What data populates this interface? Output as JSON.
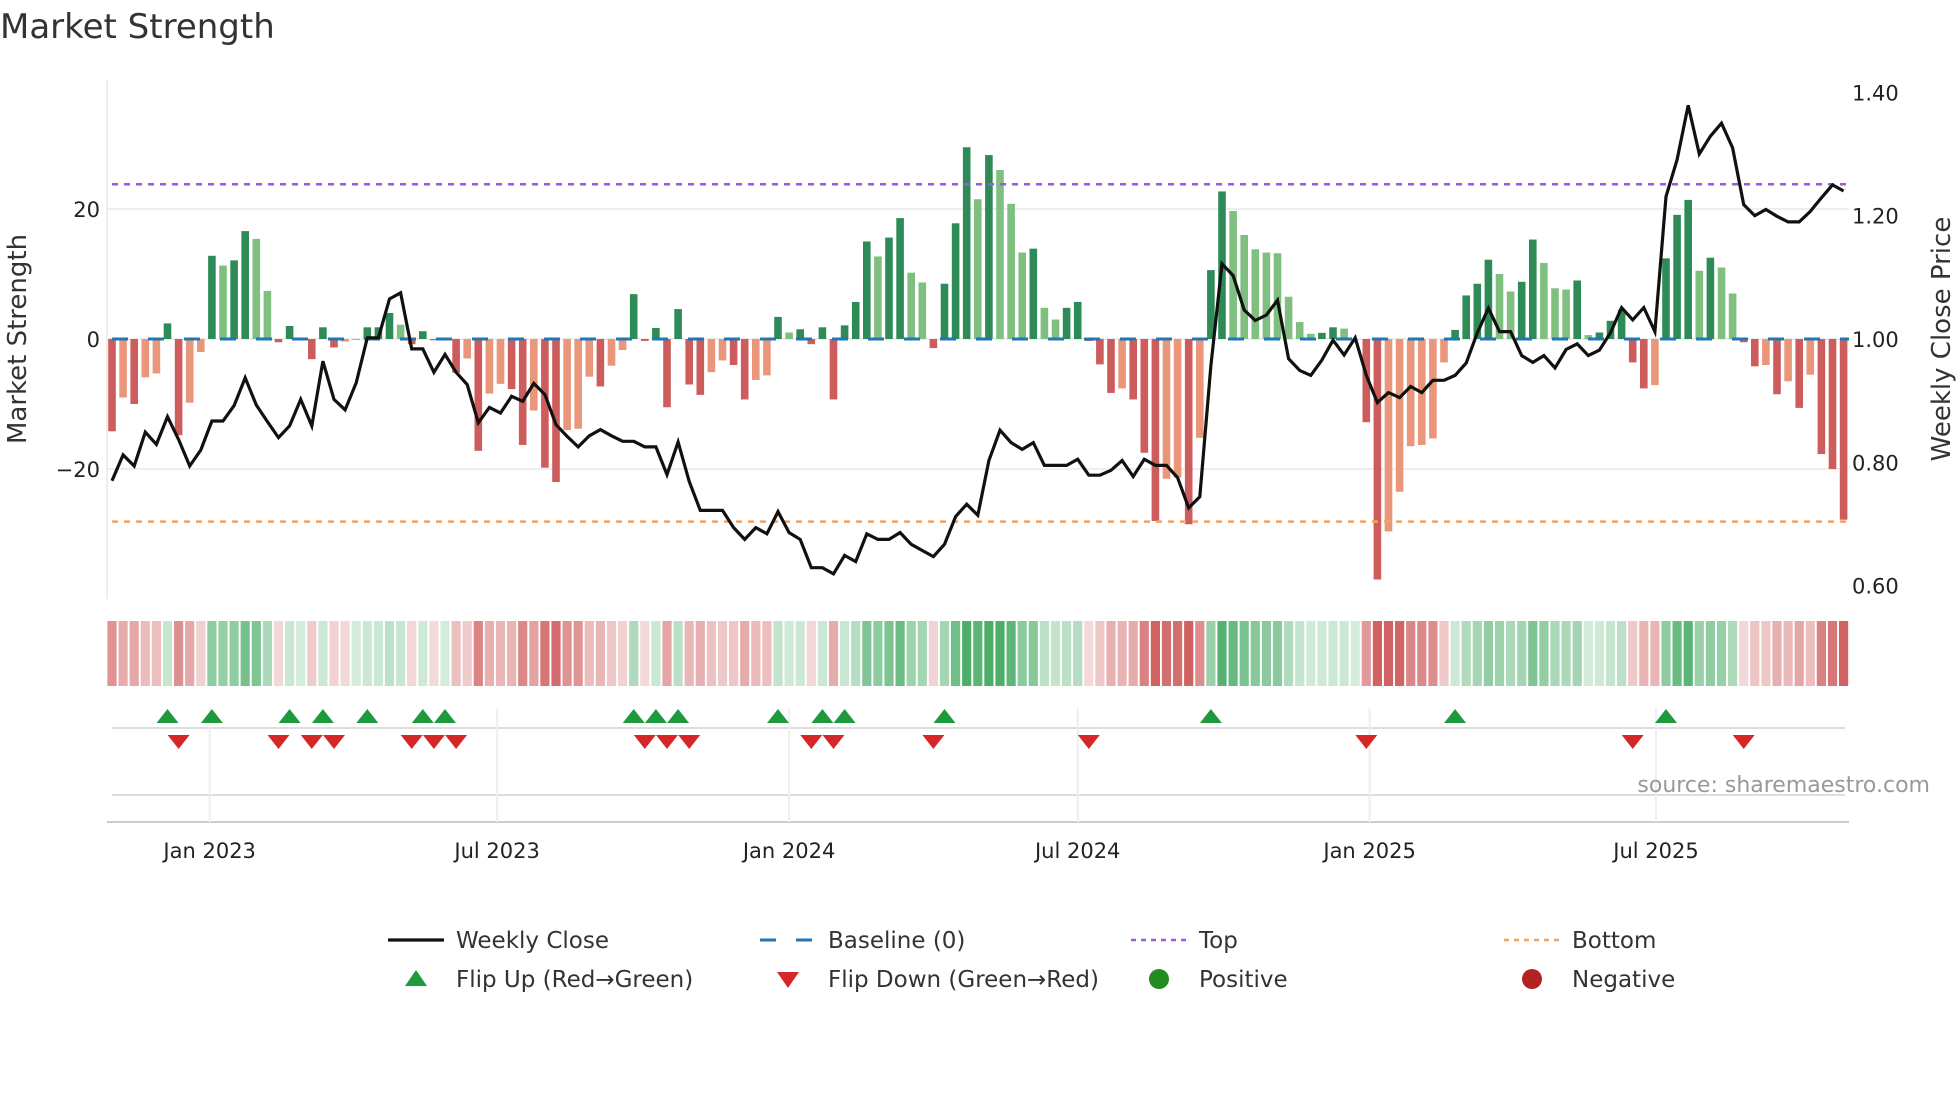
{
  "title": "Market Strength",
  "source": "source: sharemaestro.com",
  "chart_data": {
    "type": "bar",
    "title": "Market Strength",
    "ylabel": "Market Strength",
    "y2label": "Weekly Close Price",
    "ylim": [
      -40,
      40
    ],
    "y2lim": [
      0.6,
      1.4
    ],
    "yticks": [
      "20",
      "0",
      "−20"
    ],
    "ytick_values": [
      20,
      0,
      -20
    ],
    "y2ticks": [
      "1.40",
      "1.20",
      "1.00",
      "0.80",
      "0.60"
    ],
    "y2tick_values": [
      1.4,
      1.2,
      1.0,
      0.8,
      0.6
    ],
    "xticks": [
      {
        "label": "Jan 2023",
        "week": 8.8
      },
      {
        "label": "Jul 2023",
        "week": 34.7
      },
      {
        "label": "Jan 2024",
        "week": 61.0
      },
      {
        "label": "Jul 2024",
        "week": 87.0
      },
      {
        "label": "Jan 2025",
        "week": 113.3
      },
      {
        "label": "Jul 2025",
        "week": 139.1
      }
    ],
    "top": 23.8,
    "bottom": -28.1,
    "baseline": 0,
    "strength": [
      -14.2,
      -9,
      -10,
      -5.9,
      -5.3,
      2.4,
      -14.8,
      -9.8,
      -2,
      12.8,
      11.3,
      12.1,
      16.6,
      15.4,
      7.4,
      -0.5,
      2,
      0.2,
      -3.1,
      1.8,
      -1.3,
      -0.4,
      0,
      1.8,
      1.8,
      4,
      2.2,
      -0.8,
      1.2,
      -0.2,
      0.2,
      -5.2,
      -3,
      -17.2,
      -8.4,
      -6.9,
      -7.7,
      -16.3,
      -11,
      -19.8,
      -22,
      -14,
      -13.8,
      -5.8,
      -7.3,
      -4.1,
      -1.7,
      6.9,
      -0.3,
      1.7,
      -10.5,
      4.6,
      -7,
      -8.6,
      -5.1,
      -3.3,
      -4,
      -9.3,
      -6.3,
      -5.6,
      3.4,
      1,
      1.5,
      -0.8,
      1.8,
      -9.3,
      2.1,
      5.7,
      15,
      12.7,
      15.6,
      18.6,
      10.2,
      8.7,
      -1.4,
      8.5,
      17.8,
      29.5,
      21.5,
      28.3,
      26,
      20.8,
      13.3,
      13.9,
      4.8,
      3,
      4.8,
      5.7,
      -0.3,
      -3.9,
      -8.3,
      -7.6,
      -9.3,
      -17.5,
      -28,
      -21.5,
      -21.3,
      -28.5,
      -15.2,
      10.6,
      22.7,
      19.7,
      16,
      13.8,
      13.3,
      13.2,
      6.5,
      2.6,
      0.8,
      0.95,
      1.8,
      1.6,
      0,
      -12.8,
      -37,
      -29.6,
      -23.5,
      -16.5,
      -16.3,
      -15.3,
      -3.6,
      1.4,
      6.7,
      8.5,
      12.2,
      10,
      7.3,
      8.8,
      15.3,
      11.7,
      7.8,
      7.6,
      9,
      0.6,
      1,
      2.8,
      4.5,
      -3.6,
      -7.6,
      -7.1,
      12.4,
      19.1,
      21.4,
      10.5,
      12.5,
      11,
      7,
      -0.5,
      -4.2,
      -4,
      -8.5,
      -6.5,
      -10.6,
      -5.5,
      -17.7,
      -20,
      -27.8
    ],
    "weekly_close": [
      0.77,
      0.812,
      0.794,
      0.849,
      0.829,
      0.874,
      0.837,
      0.794,
      0.82,
      0.867,
      0.867,
      0.892,
      0.937,
      0.893,
      0.866,
      0.84,
      0.859,
      0.902,
      0.859,
      0.964,
      0.902,
      0.885,
      0.929,
      1.002,
      1.002,
      1.065,
      1.075,
      0.984,
      0.984,
      0.946,
      0.975,
      0.946,
      0.926,
      0.864,
      0.889,
      0.88,
      0.907,
      0.899,
      0.928,
      0.91,
      0.861,
      0.842,
      0.825,
      0.843,
      0.853,
      0.843,
      0.834,
      0.834,
      0.825,
      0.825,
      0.78,
      0.833,
      0.769,
      0.722,
      0.722,
      0.722,
      0.694,
      0.675,
      0.694,
      0.684,
      0.72,
      0.686,
      0.675,
      0.629,
      0.629,
      0.619,
      0.649,
      0.639,
      0.684,
      0.675,
      0.675,
      0.686,
      0.667,
      0.657,
      0.647,
      0.667,
      0.712,
      0.732,
      0.714,
      0.803,
      0.852,
      0.832,
      0.821,
      0.832,
      0.795,
      0.795,
      0.795,
      0.805,
      0.779,
      0.779,
      0.787,
      0.803,
      0.777,
      0.805,
      0.795,
      0.795,
      0.775,
      0.726,
      0.744,
      0.957,
      1.122,
      1.103,
      1.047,
      1.03,
      1.039,
      1.063,
      0.968,
      0.949,
      0.941,
      0.966,
      0.998,
      0.974,
      1.002,
      0.941,
      0.897,
      0.913,
      0.905,
      0.923,
      0.913,
      0.933,
      0.933,
      0.941,
      0.961,
      1.01,
      1.05,
      1.012,
      1.012,
      0.973,
      0.962,
      0.973,
      0.953,
      0.983,
      0.992,
      0.973,
      0.982,
      1.01,
      1.051,
      1.031,
      1.051,
      1.012,
      1.231,
      1.291,
      1.379,
      1.3,
      1.329,
      1.35,
      1.31,
      1.218,
      1.2,
      1.21,
      1.199,
      1.19,
      1.19,
      1.207,
      1.229,
      1.25,
      1.24
    ],
    "legend": {
      "placement": "bottom",
      "items": [
        {
          "label": "Weekly Close",
          "kind": "line"
        },
        {
          "label": "Baseline (0)",
          "kind": "dash"
        },
        {
          "label": "Top",
          "kind": "dot"
        },
        {
          "label": "Bottom",
          "kind": "dot"
        },
        {
          "label": "Flip Up (Red→Green)",
          "kind": "up"
        },
        {
          "label": "Flip Down (Green→Red)",
          "kind": "down"
        },
        {
          "label": "Positive",
          "kind": "circle"
        },
        {
          "label": "Negative",
          "kind": "circle"
        }
      ]
    },
    "colors": {
      "pos_strong": "#2e8b57",
      "pos_weak": "#7fbf7f",
      "neg_strong": "#cd5c5c",
      "neg_weak": "#e9967a",
      "close": "#111111",
      "baseline": "#1f77b4",
      "top": "#9b59e0",
      "bottom": "#f4a261",
      "flip_up": "#1e9a3c",
      "flip_down": "#d62728",
      "positive": "#228b22",
      "negative": "#b22222"
    }
  }
}
